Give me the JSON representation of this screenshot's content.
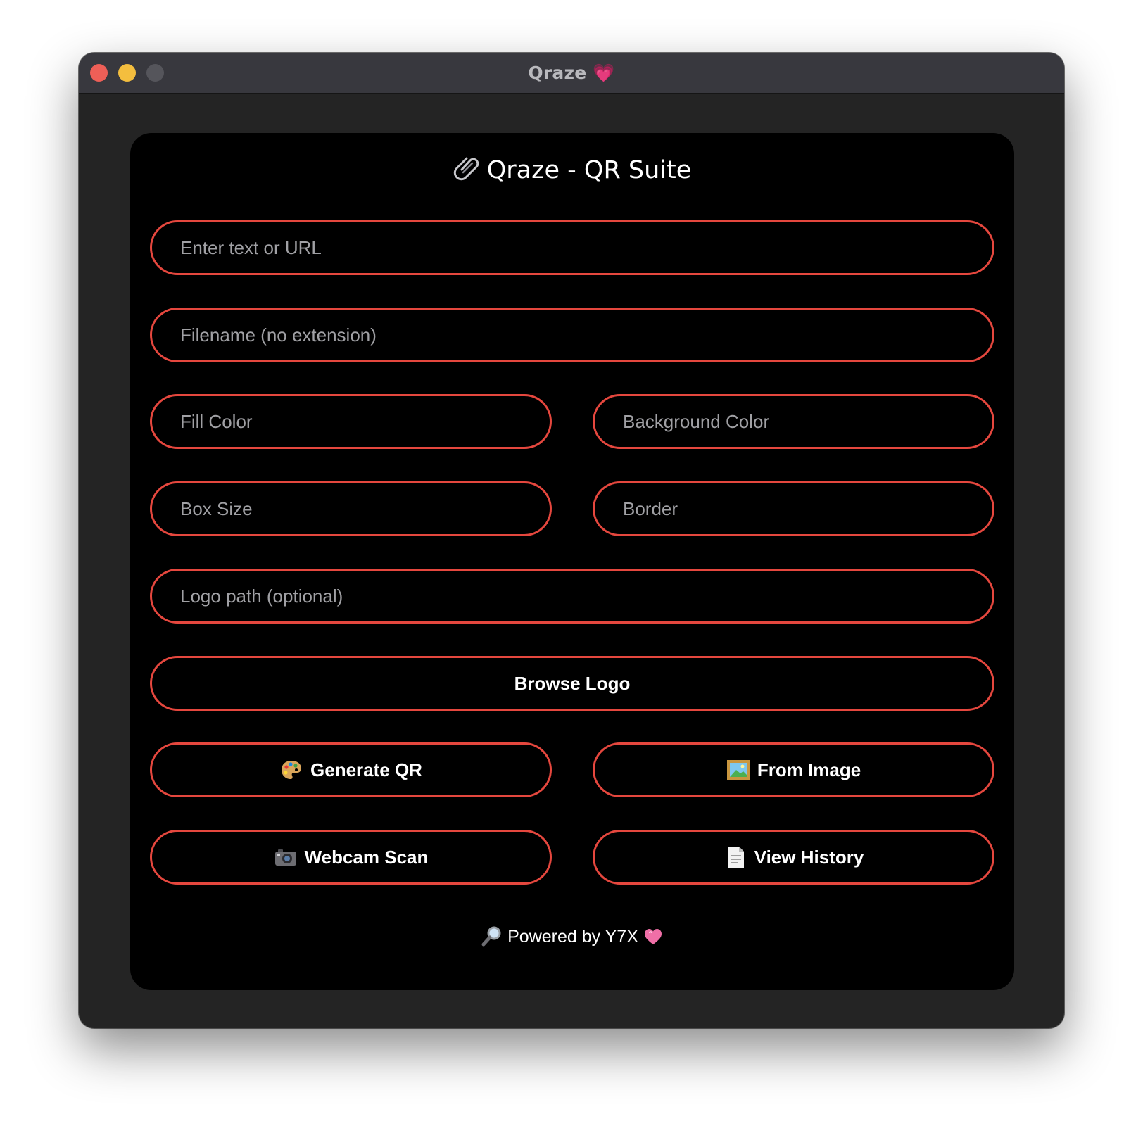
{
  "window": {
    "title": "Qraze 💗"
  },
  "app": {
    "title": "Qraze - QR Suite",
    "title_icon": "paperclip-icon"
  },
  "fields": {
    "text_url": {
      "placeholder": "Enter text or URL",
      "value": ""
    },
    "filename": {
      "placeholder": "Filename (no extension)",
      "value": ""
    },
    "fill_color": {
      "placeholder": "Fill Color",
      "value": ""
    },
    "background_color": {
      "placeholder": "Background Color",
      "value": ""
    },
    "box_size": {
      "placeholder": "Box Size",
      "value": ""
    },
    "border": {
      "placeholder": "Border",
      "value": ""
    },
    "logo_path": {
      "placeholder": "Logo path (optional)",
      "value": ""
    }
  },
  "buttons": {
    "browse_logo": "Browse Logo",
    "generate_qr": {
      "label": "Generate QR",
      "icon": "palette-icon"
    },
    "from_image": {
      "label": "From Image",
      "icon": "framed-picture-icon"
    },
    "webcam_scan": {
      "label": "Webcam Scan",
      "icon": "camera-icon"
    },
    "view_history": {
      "label": "View History",
      "icon": "page-icon"
    }
  },
  "footer": {
    "text": "Powered by Y7X",
    "icon": "magnifier-icon",
    "trailing_icon": "heart-icon"
  },
  "colors": {
    "accent_border": "#e5473e",
    "panel_bg": "#000000",
    "window_bg": "#242424",
    "titlebar_bg": "#38383e",
    "placeholder_text": "#a0a0a4"
  }
}
